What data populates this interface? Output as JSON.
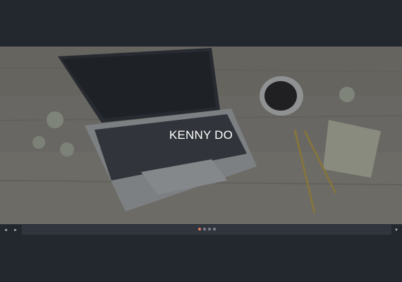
{
  "hero": {
    "title": "KENNY DO",
    "background_image": "laptop-coffee-desk-photo"
  },
  "controls": {
    "prev_icon": "chevron-left-icon",
    "next_icon": "chevron-right-icon",
    "down_icon": "chevron-down-icon",
    "prev_glyph": "◂",
    "next_glyph": "▸",
    "down_glyph": "▾"
  },
  "pagination": {
    "count": 4,
    "active_index": 0
  },
  "colors": {
    "background": "#23272e",
    "bar": "#30353e",
    "dot": "#7c8088",
    "dot_active": "#e07a5f",
    "title": "#ffffff"
  }
}
